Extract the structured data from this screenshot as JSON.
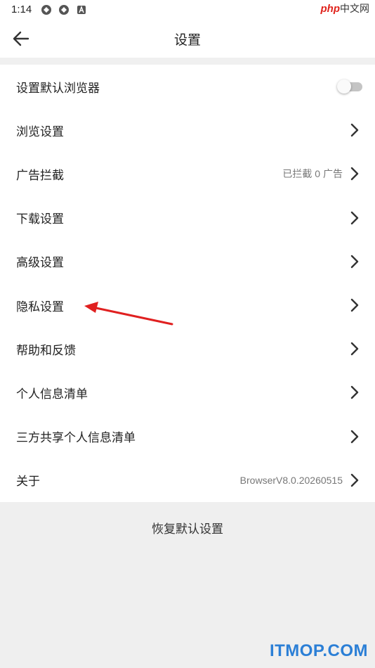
{
  "status_bar": {
    "time": "1:14"
  },
  "watermark_top": {
    "brand": "php",
    "suffix": "中文网"
  },
  "app_bar": {
    "title": "设置",
    "back_icon": "arrow-left-icon"
  },
  "settings": {
    "items": [
      {
        "label": "设置默认浏览器",
        "control": "toggle",
        "toggle_on": false
      },
      {
        "label": "浏览设置",
        "control": "chevron"
      },
      {
        "label": "广告拦截",
        "value": "已拦截 0 广告",
        "control": "chevron"
      },
      {
        "label": "下载设置",
        "control": "chevron"
      },
      {
        "label": "高级设置",
        "control": "chevron"
      },
      {
        "label": "隐私设置",
        "control": "chevron"
      },
      {
        "label": "帮助和反馈",
        "control": "chevron"
      },
      {
        "label": "个人信息清单",
        "control": "chevron"
      },
      {
        "label": "三方共享个人信息清单",
        "control": "chevron"
      },
      {
        "label": "关于",
        "value": "BrowserV8.0.20260515",
        "control": "chevron"
      }
    ]
  },
  "reset": {
    "label": "恢复默认设置"
  },
  "watermark_bottom": {
    "text": "ITMOP.COM"
  },
  "colors": {
    "annotation_arrow": "#e02020",
    "watermark_blue": "#2b7fd6",
    "background_gray": "#efefef"
  }
}
